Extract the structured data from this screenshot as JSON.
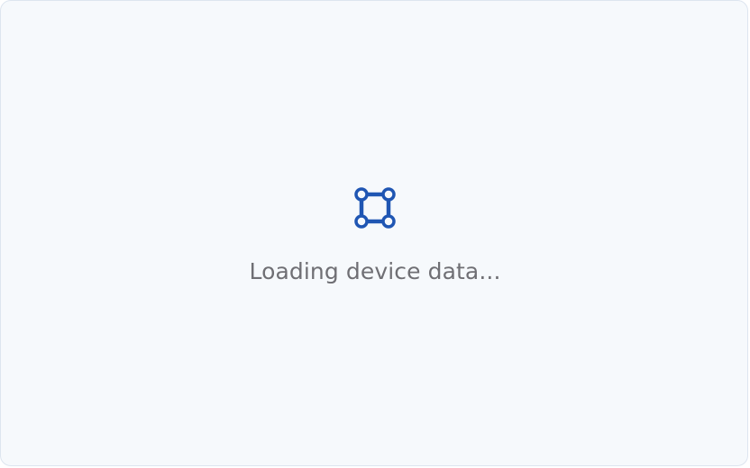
{
  "loading": {
    "message": "Loading device data..."
  },
  "icon": {
    "name": "device-nodes-icon",
    "color": "#1f56b3"
  }
}
